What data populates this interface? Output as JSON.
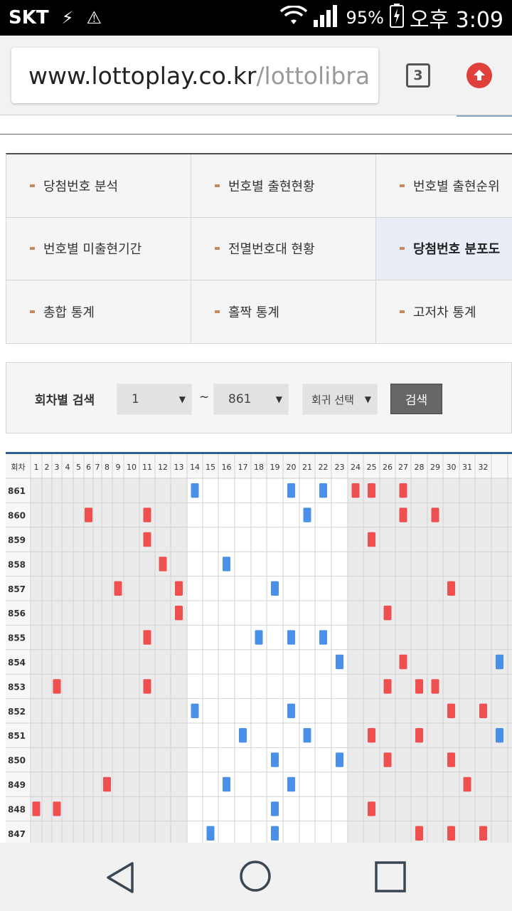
{
  "status_bar": {
    "carrier": "SKT",
    "battery": "95%",
    "time": "오후 3:09"
  },
  "browser": {
    "url_host": "www.lottoplay.co.kr",
    "url_path": "/lottolibra",
    "tab_count": "3"
  },
  "menu": {
    "rows": [
      [
        {
          "label": "당첨번호 분석"
        },
        {
          "label": "번호별 출현현황"
        },
        {
          "label": "번호별 출현순위"
        }
      ],
      [
        {
          "label": "번호별 미출현기간"
        },
        {
          "label": "전멸번호대 현황"
        },
        {
          "label": "당첨번호 분포도",
          "active": true
        }
      ],
      [
        {
          "label": "총합 통계"
        },
        {
          "label": "홀짝 통계"
        },
        {
          "label": "고저차 통계"
        }
      ]
    ]
  },
  "search": {
    "label": "회차별 검색",
    "from_value": "1",
    "to_value": "861",
    "tilde": "~",
    "select_round": "회귀 선택",
    "button": "검색"
  },
  "grid": {
    "round_header": "회차",
    "number_headers": [
      "1",
      "2",
      "3",
      "4",
      "5",
      "6",
      "7",
      "8",
      "9",
      "10",
      "11",
      "12",
      "13",
      "14",
      "15",
      "16",
      "17",
      "18",
      "19",
      "20",
      "21",
      "22",
      "23",
      "24",
      "25",
      "26",
      "27",
      "28",
      "29",
      "30",
      "31",
      "32"
    ],
    "colors": {
      "red": "#f04f4f",
      "blue": "#4a8fe8",
      "gray_band": "#ebebeb",
      "white_band": "#ffffff"
    },
    "rows": [
      {
        "round": "861",
        "marks": [
          {
            "n": 14,
            "c": "blue"
          },
          {
            "n": 20,
            "c": "blue"
          },
          {
            "n": 22,
            "c": "blue"
          },
          {
            "n": 24,
            "c": "red"
          },
          {
            "n": 25,
            "c": "red"
          },
          {
            "n": 27,
            "c": "red"
          }
        ]
      },
      {
        "round": "860",
        "marks": [
          {
            "n": 6,
            "c": "red"
          },
          {
            "n": 11,
            "c": "red"
          },
          {
            "n": 21,
            "c": "blue"
          },
          {
            "n": 27,
            "c": "red"
          },
          {
            "n": 29,
            "c": "red"
          }
        ]
      },
      {
        "round": "859",
        "marks": [
          {
            "n": 11,
            "c": "red"
          },
          {
            "n": 25,
            "c": "red"
          }
        ]
      },
      {
        "round": "858",
        "marks": [
          {
            "n": 12,
            "c": "red"
          },
          {
            "n": 16,
            "c": "blue"
          }
        ]
      },
      {
        "round": "857",
        "marks": [
          {
            "n": 9,
            "c": "red"
          },
          {
            "n": 13,
            "c": "red"
          },
          {
            "n": 19,
            "c": "blue"
          },
          {
            "n": 30,
            "c": "red"
          }
        ]
      },
      {
        "round": "856",
        "marks": [
          {
            "n": 13,
            "c": "red"
          },
          {
            "n": 26,
            "c": "red"
          }
        ]
      },
      {
        "round": "855",
        "marks": [
          {
            "n": 11,
            "c": "red"
          },
          {
            "n": 18,
            "c": "blue"
          },
          {
            "n": 20,
            "c": "blue"
          },
          {
            "n": 22,
            "c": "blue"
          }
        ]
      },
      {
        "round": "854",
        "marks": [
          {
            "n": 23,
            "c": "blue"
          },
          {
            "n": 27,
            "c": "red"
          },
          {
            "n": 33,
            "c": "blue"
          }
        ]
      },
      {
        "round": "853",
        "marks": [
          {
            "n": 3,
            "c": "red"
          },
          {
            "n": 11,
            "c": "red"
          },
          {
            "n": 26,
            "c": "red"
          },
          {
            "n": 28,
            "c": "red"
          },
          {
            "n": 29,
            "c": "red"
          }
        ]
      },
      {
        "round": "852",
        "marks": [
          {
            "n": 14,
            "c": "blue"
          },
          {
            "n": 20,
            "c": "blue"
          },
          {
            "n": 30,
            "c": "red"
          },
          {
            "n": 32,
            "c": "red"
          }
        ]
      },
      {
        "round": "851",
        "marks": [
          {
            "n": 17,
            "c": "blue"
          },
          {
            "n": 21,
            "c": "blue"
          },
          {
            "n": 25,
            "c": "red"
          },
          {
            "n": 28,
            "c": "red"
          },
          {
            "n": 33,
            "c": "blue"
          }
        ]
      },
      {
        "round": "850",
        "marks": [
          {
            "n": 19,
            "c": "blue"
          },
          {
            "n": 23,
            "c": "blue"
          },
          {
            "n": 26,
            "c": "red"
          },
          {
            "n": 30,
            "c": "red"
          }
        ]
      },
      {
        "round": "849",
        "marks": [
          {
            "n": 8,
            "c": "red"
          },
          {
            "n": 16,
            "c": "blue"
          },
          {
            "n": 20,
            "c": "blue"
          },
          {
            "n": 31,
            "c": "red"
          }
        ]
      },
      {
        "round": "848",
        "marks": [
          {
            "n": 1,
            "c": "red"
          },
          {
            "n": 3,
            "c": "red"
          },
          {
            "n": 19,
            "c": "blue"
          },
          {
            "n": 25,
            "c": "red"
          }
        ]
      },
      {
        "round": "847",
        "marks": [
          {
            "n": 15,
            "c": "blue"
          },
          {
            "n": 19,
            "c": "blue"
          },
          {
            "n": 28,
            "c": "red"
          },
          {
            "n": 30,
            "c": "red"
          },
          {
            "n": 32,
            "c": "red"
          }
        ]
      }
    ]
  },
  "nav_bar": {
    "icons": [
      "back-icon",
      "home-icon",
      "recents-icon"
    ]
  }
}
